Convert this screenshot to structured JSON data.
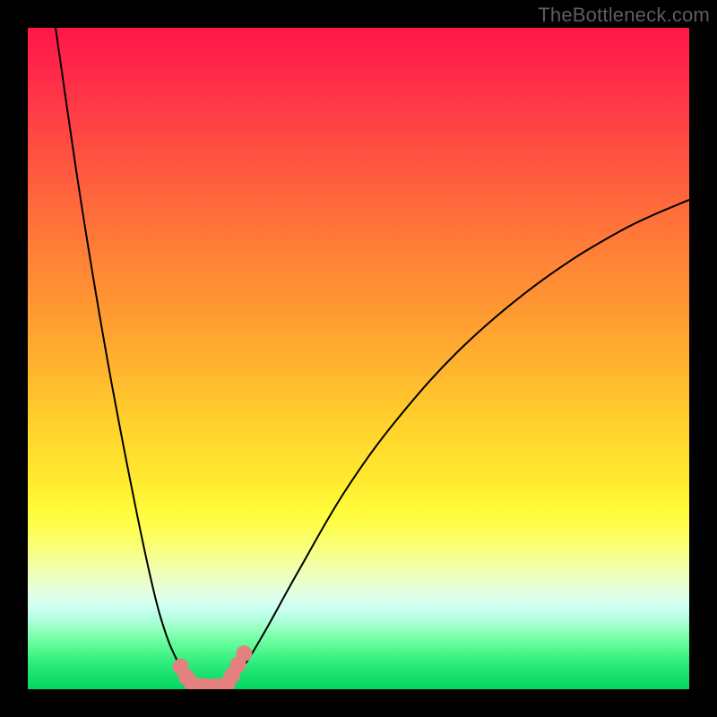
{
  "watermark": "TheBottleneck.com",
  "chart_data": {
    "type": "line",
    "title": "",
    "xlabel": "",
    "ylabel": "",
    "xlim": [
      0,
      100
    ],
    "ylim": [
      0,
      100
    ],
    "grid": false,
    "legend": false,
    "background_gradient_stops": [
      {
        "pct": 0,
        "color": "#ff1846"
      },
      {
        "pct": 22,
        "color": "#ff5a3f"
      },
      {
        "pct": 52,
        "color": "#ffb62e"
      },
      {
        "pct": 73,
        "color": "#fffb3a"
      },
      {
        "pct": 86,
        "color": "#dcffed"
      },
      {
        "pct": 100,
        "color": "#07d662"
      }
    ],
    "series": [
      {
        "name": "curve-left",
        "stroke": "#000000",
        "stroke_width": 2,
        "x": [
          4.2,
          8,
          12,
          16,
          19,
          21,
          22.5,
          23.5,
          24.2,
          25
        ],
        "y": [
          100,
          74,
          50,
          29,
          15,
          8,
          4.5,
          2.5,
          1.2,
          0.4
        ]
      },
      {
        "name": "curve-right",
        "stroke": "#000000",
        "stroke_width": 2,
        "x": [
          30,
          31,
          33,
          36,
          41,
          48,
          56,
          66,
          78,
          90,
          100
        ],
        "y": [
          0.4,
          1.5,
          4,
          9,
          18,
          30,
          41,
          52,
          62,
          69.5,
          74
        ]
      },
      {
        "name": "baseline",
        "stroke": "#000000",
        "stroke_width": 2,
        "x": [
          25,
          30
        ],
        "y": [
          0.4,
          0.4
        ]
      },
      {
        "name": "marker-left",
        "type": "scatter",
        "color": "#e58080",
        "radius": 9,
        "x": [
          23.1,
          24.0,
          24.8,
          25.8
        ],
        "y": [
          3.4,
          1.8,
          0.9,
          0.5
        ]
      },
      {
        "name": "marker-right",
        "type": "scatter",
        "color": "#e58080",
        "radius": 9,
        "x": [
          30.2,
          30.9,
          31.8,
          32.7
        ],
        "y": [
          0.9,
          2.1,
          3.7,
          5.4
        ]
      },
      {
        "name": "marker-baseline",
        "type": "scatter",
        "color": "#e58080",
        "radius": 9,
        "x": [
          27.0,
          28.3,
          29.5
        ],
        "y": [
          0.45,
          0.45,
          0.45
        ]
      }
    ]
  }
}
